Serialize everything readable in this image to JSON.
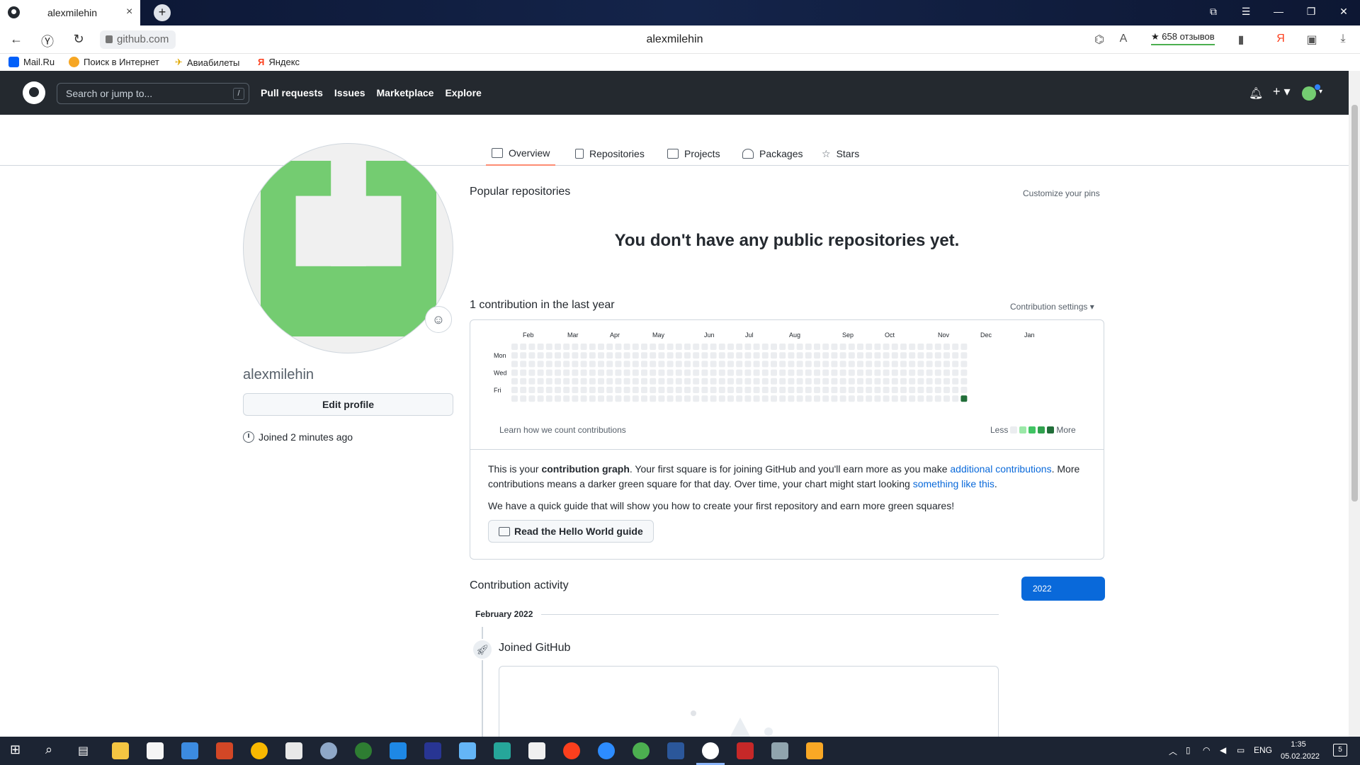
{
  "browser": {
    "tab_title": "alexmilehin",
    "tab_close": "×",
    "new_tab": "+",
    "url": "github.com",
    "page_title": "alexmilehin",
    "rating": "★ 658 отзывов",
    "bookmarks": [
      {
        "label": "Mail.Ru",
        "color": "#005ff9"
      },
      {
        "label": "Поиск в Интернет",
        "color": "#f6a623"
      },
      {
        "label": "Авиабилеты",
        "color": "#ffd500"
      },
      {
        "label": "Яндекс",
        "color": "#fc3f1d"
      }
    ]
  },
  "github_header": {
    "search_placeholder": "Search or jump to...",
    "search_key": "/",
    "nav": [
      "Pull requests",
      "Issues",
      "Marketplace",
      "Explore"
    ]
  },
  "profile_tabs": [
    {
      "label": "Overview",
      "icon": "book-icon",
      "active": true
    },
    {
      "label": "Repositories",
      "icon": "repo-icon"
    },
    {
      "label": "Projects",
      "icon": "project-icon"
    },
    {
      "label": "Packages",
      "icon": "package-icon"
    },
    {
      "label": "Stars",
      "icon": "star-icon"
    }
  ],
  "profile": {
    "username": "alexmilehin",
    "edit_label": "Edit profile",
    "joined": "Joined 2 minutes ago",
    "identicon_color": "#74cc71"
  },
  "popular": {
    "title": "Popular repositories",
    "customize": "Customize your pins",
    "empty": "You don't have any public repositories yet."
  },
  "contributions": {
    "title": "1 contribution in the last year",
    "settings": "Contribution settings ▾",
    "months": [
      "Feb",
      "Mar",
      "Apr",
      "May",
      "Jun",
      "Jul",
      "Aug",
      "Sep",
      "Oct",
      "Nov",
      "Dec",
      "Jan"
    ],
    "days": [
      "Mon",
      "Wed",
      "Fri"
    ],
    "learn": "Learn how we count contributions",
    "legend_less": "Less",
    "legend_more": "More",
    "legend_colors": [
      "#ebedf0",
      "#9be9a8",
      "#40c463",
      "#30a14e",
      "#216e39"
    ],
    "week_count": 53,
    "last_week_filled_day": 6,
    "empty_color": "#ebedf0",
    "filled_color": "#216e39",
    "info_1_a": "This is your ",
    "info_1_b": "contribution graph",
    "info_1_c": ". Your first square is for joining GitHub and you'll earn more as you make ",
    "info_1_link1": "additional contributions",
    "info_1_d": ". More contributions means a darker green square for that day. Over time, your chart might start looking ",
    "info_1_link2": "something like this",
    "info_1_e": ".",
    "info_2": "We have a quick guide that will show you how to create your first repository and earn more green squares!",
    "guide_button": "Read the Hello World guide"
  },
  "activity": {
    "title": "Contribution activity",
    "year": "2022",
    "month": "February 2022",
    "event": "Joined GitHub"
  },
  "taskbar": {
    "lang": "ENG",
    "time": "1:35",
    "date": "05.02.2022",
    "notifications": "5"
  }
}
